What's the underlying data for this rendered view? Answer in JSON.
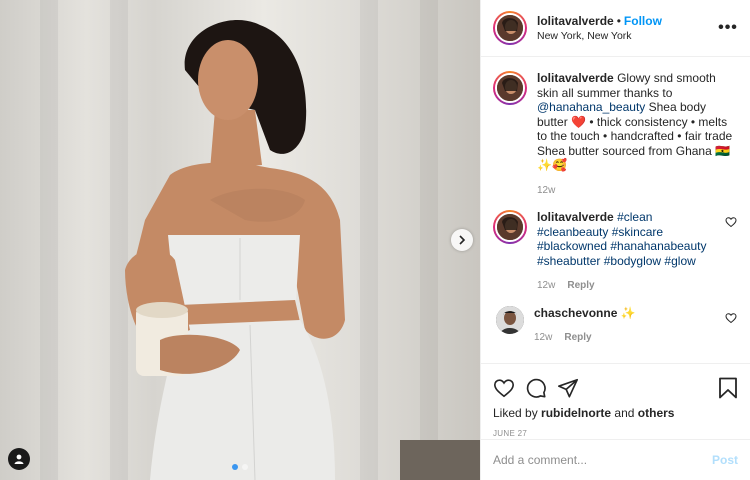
{
  "post": {
    "author": "lolitavalverde",
    "follow_label": "Follow",
    "separator": "•",
    "location": "New York, New York",
    "more_label": "•••"
  },
  "caption": {
    "username": "lolitavalverde",
    "text_1": "Glowy snd smooth skin all summer thanks to",
    "mention": "@hanahana_beauty",
    "text_2": "Shea body butter",
    "heart": "❤️",
    "text_3": "• thick consistency • melts to the touch • handcrafted • fair trade Shea butter sourced from Ghana 🇬🇭 ✨🥰",
    "age": "12w"
  },
  "comments": [
    {
      "username": "lolitavalverde",
      "hashtags": "#clean #cleanbeauty #skincare #blackowned #hanahanabeauty #sheabutter #bodyglow #glow",
      "age": "12w",
      "reply_label": "Reply"
    },
    {
      "username": "chaschevonne",
      "text": "✨",
      "age": "12w",
      "reply_label": "Reply"
    }
  ],
  "likes": {
    "prefix": "Liked by",
    "user": "rubidelnorte",
    "and": "and",
    "others": "others"
  },
  "date": "JUNE 27",
  "add_comment": {
    "placeholder": "Add a comment...",
    "post_label": "Post"
  },
  "colors": {
    "accent": "#0095f6",
    "link": "#00376b",
    "muted": "#8e8e8e",
    "post_disabled": "#b2dffc",
    "dot_active": "#3a96f0"
  },
  "icons": [
    "heart-icon",
    "comment-icon",
    "share-icon",
    "bookmark-icon",
    "chevron-right-icon",
    "user-tag-icon",
    "more-options-icon"
  ]
}
